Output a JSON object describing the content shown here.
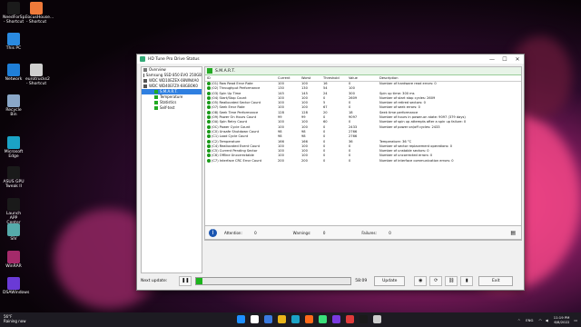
{
  "desktop": {
    "icons": [
      {
        "label": "NeedForSp... - Shortcut",
        "color": "#1b1b1b"
      },
      {
        "label": "FocusHouse... - Shortcut",
        "color": "#ef7a3a"
      },
      {
        "label": "This PC",
        "color": "#2a8ae0"
      },
      {
        "label": "Network",
        "color": "#1f7fd8"
      },
      {
        "label": "eurotrucks2 - Shortcut",
        "color": "#cfcfcf"
      },
      {
        "label": "Recycle Bin",
        "color": "#8aa7c8"
      },
      {
        "label": "Microsoft Edge",
        "color": "#1ba3c6"
      },
      {
        "label": "ASUS GPU Tweak II",
        "color": "#1a1a1a"
      },
      {
        "label": "Launch APP Center",
        "color": "#1a1a1a"
      },
      {
        "label": "SIV",
        "color": "#5aa"
      },
      {
        "label": "WinRAR",
        "color": "#a42a6a"
      },
      {
        "label": "DSAWindows",
        "color": "#6a3ad6"
      }
    ]
  },
  "window": {
    "title": "HD Tune Pro Drive Status",
    "controls": {
      "minimize": "—",
      "maximize": "☐",
      "close": "✕"
    }
  },
  "tree": {
    "items": [
      {
        "label": "Overview",
        "indent": 0,
        "selected": false,
        "color": "#777"
      },
      {
        "label": "Samsung SSD 850 EVO 250GB",
        "indent": 0,
        "selected": false,
        "color": "#555"
      },
      {
        "label": "WDC WD10EZEX-08WN4A0",
        "indent": 0,
        "selected": false,
        "color": "#555"
      },
      {
        "label": "WDC WD40EFZX-68GBOK0",
        "indent": 0,
        "selected": false,
        "color": "#555"
      },
      {
        "label": "S.M.A.R.T.",
        "indent": 1,
        "selected": true,
        "color": "#2a2"
      },
      {
        "label": "Temperature",
        "indent": 1,
        "selected": false,
        "color": "#2a2"
      },
      {
        "label": "Statistics",
        "indent": 1,
        "selected": false,
        "color": "#2a2"
      },
      {
        "label": "Self-test",
        "indent": 1,
        "selected": false,
        "color": "#2a2"
      }
    ]
  },
  "smart": {
    "header": "S.M.A.R.T.",
    "columns": [
      "ID",
      "Current",
      "Worst",
      "Threshold",
      "Value",
      "Description"
    ],
    "rows": [
      [
        "(01) Raw Read Error Rate",
        "100",
        "100",
        "16",
        "0",
        "Number of hardware read errors: 0"
      ],
      [
        "(02) Throughput Performance",
        "130",
        "130",
        "54",
        "100",
        ""
      ],
      [
        "(03) Spin Up Time",
        "145",
        "145",
        "24",
        "300",
        "Spin up time: 300 ms"
      ],
      [
        "(04) Start/Stop Count",
        "100",
        "100",
        "0",
        "2609",
        "Number of start stop cycles: 2609"
      ],
      [
        "(05) Reallocated Sector Count",
        "100",
        "100",
        "5",
        "0",
        "Number of retired sectors: 0"
      ],
      [
        "(07) Seek Error Rate",
        "100",
        "100",
        "67",
        "0",
        "Number of seek errors: 0"
      ],
      [
        "(08) Seek Time Performance",
        "128",
        "128",
        "20",
        "18",
        "Seek time performance"
      ],
      [
        "(09) Power On Hours Count",
        "99",
        "99",
        "0",
        "9097",
        "Number of hours in power-on state: 9097 (379 days)"
      ],
      [
        "(0A) Spin Retry Count",
        "100",
        "100",
        "60",
        "0",
        "Number of spin up attempts after a spin up failure: 0"
      ],
      [
        "(0C) Power Cycle Count",
        "100",
        "100",
        "0",
        "2433",
        "Number of power on/off cycles: 2433"
      ],
      [
        "(C0) Unsafe Shutdown Count",
        "98",
        "98",
        "0",
        "2766",
        ""
      ],
      [
        "(C1) Load Cycle Count",
        "98",
        "98",
        "0",
        "2766",
        ""
      ],
      [
        "(C2) Temperature",
        "166",
        "166",
        "0",
        "36",
        "Temperature: 36 °C"
      ],
      [
        "(C4) Reallocated Event Count",
        "100",
        "100",
        "0",
        "0",
        "Number of sector replacement operations: 0"
      ],
      [
        "(C5) Current Pending Sector",
        "100",
        "100",
        "0",
        "0",
        "Number of unstable sectors: 0"
      ],
      [
        "(C6) Offline Uncorrectable",
        "100",
        "100",
        "0",
        "0",
        "Number of uncorrected errors: 0"
      ],
      [
        "(C7) Interface CRC Error Count",
        "200",
        "200",
        "0",
        "0",
        "Number of interface communication errors: 0"
      ]
    ]
  },
  "info": {
    "attention_label": "Attention:",
    "attention_value": "0",
    "warnings_label": "Warnings:",
    "warnings_value": "0",
    "failures_label": "Failures:",
    "failures_value": "0"
  },
  "bottom": {
    "next_update_label": "Next update:",
    "countdown": "58:09",
    "progress_fraction": 0.04,
    "update_label": "Update",
    "exit_label": "Exit"
  },
  "taskbar": {
    "weather_temp": "56°F",
    "weather_text": "Raining now",
    "lang": "ENG",
    "time": "11:19 PM",
    "date": "6/8/2022",
    "apps": [
      "#1e8fff",
      "#ffffff",
      "#3a7adf",
      "#e8b41a",
      "#1ba3c6",
      "#ff6a1a",
      "#3adf7a",
      "#7a3adf",
      "#df3a3a",
      "#1a1a1a",
      "#cccccc"
    ]
  },
  "colors": {
    "accent": "#2f7fe0",
    "ok": "#1a9a1a",
    "progress": "#1cb41c"
  }
}
